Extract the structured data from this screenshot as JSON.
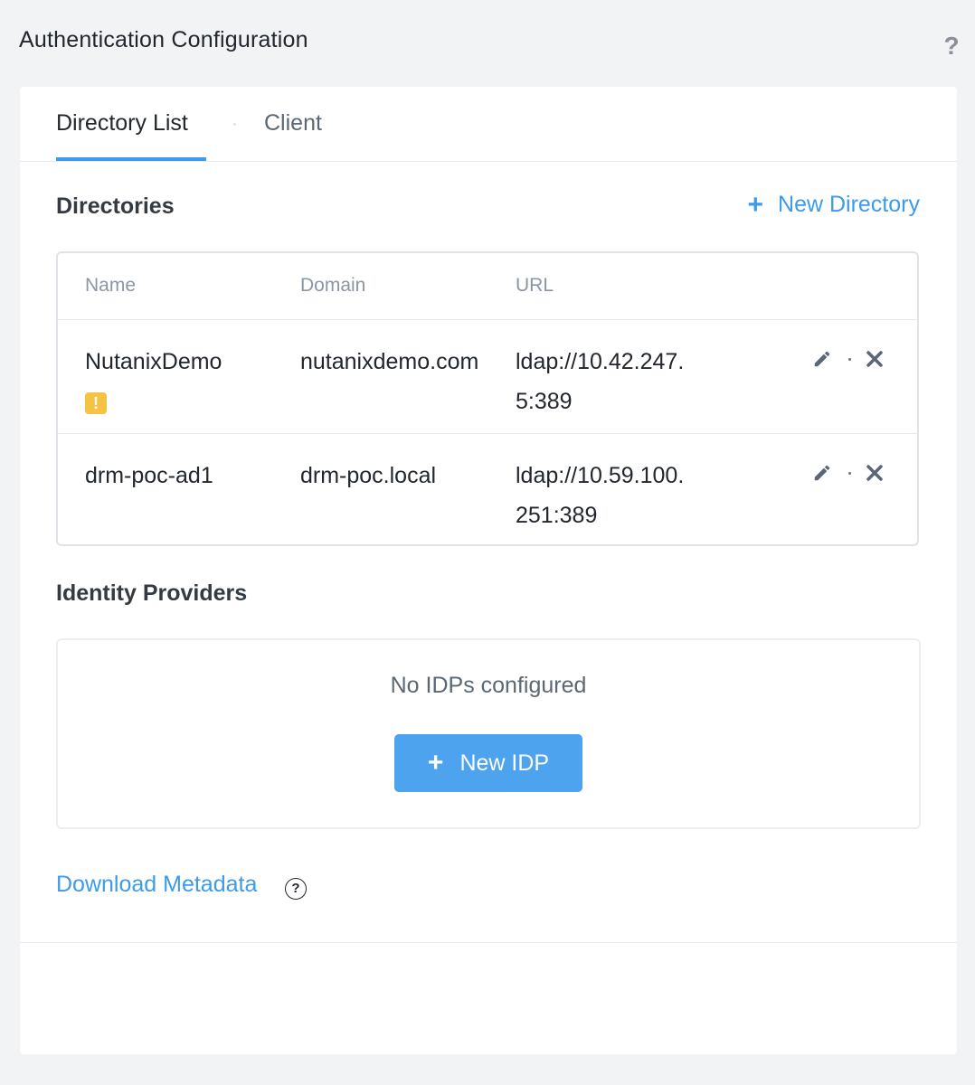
{
  "page": {
    "title": "Authentication Configuration",
    "help": "?"
  },
  "tabs": [
    {
      "label": "Directory List",
      "active": true
    },
    {
      "label": "Client",
      "active": false
    }
  ],
  "directories": {
    "title": "Directories",
    "new_label": "New Directory",
    "columns": [
      "Name",
      "Domain",
      "URL"
    ],
    "rows": [
      {
        "name": "NutanixDemo",
        "domain": "nutanixdemo.com",
        "url": "ldap://10.42.247.5:389",
        "warning": true
      },
      {
        "name": "drm-poc-ad1",
        "domain": "drm-poc.local",
        "url": "ldap://10.59.100.251:389",
        "warning": false
      }
    ]
  },
  "idp": {
    "title": "Identity Providers",
    "empty_text": "No IDPs configured",
    "new_label": "New IDP"
  },
  "download": {
    "label": "Download Metadata",
    "help": "?"
  },
  "colors": {
    "accent": "#3d9be9",
    "button": "#4da3ee",
    "warning": "#f6c244"
  },
  "icons": {
    "edit": "pencil-icon",
    "delete": "close-icon",
    "warning": "warning-icon",
    "plus": "plus-icon",
    "help": "question-icon"
  }
}
